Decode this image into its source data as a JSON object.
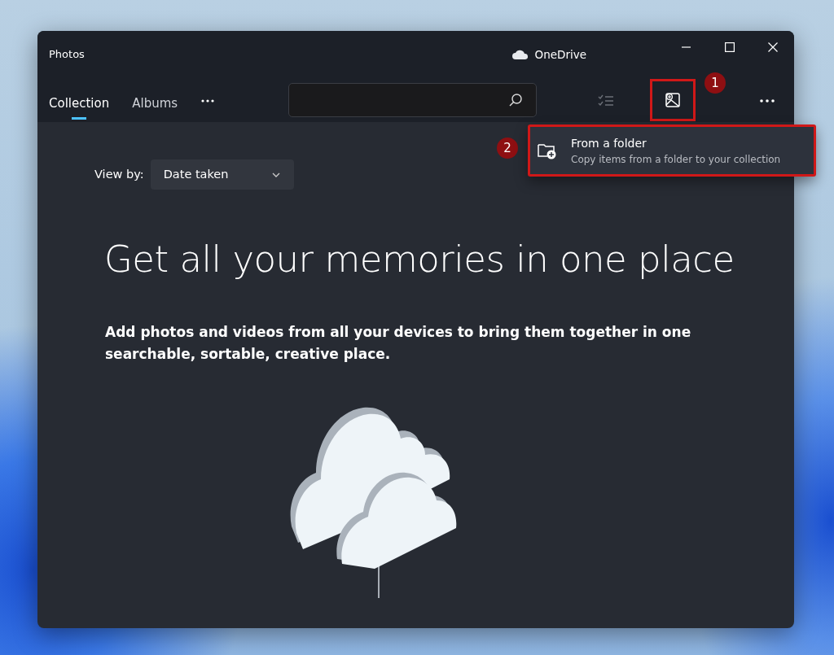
{
  "window": {
    "title": "Photos",
    "account": "OneDrive"
  },
  "tabs": [
    {
      "label": "Collection",
      "selected": true
    },
    {
      "label": "Albums",
      "selected": false
    }
  ],
  "import_button": {
    "highlighted": true,
    "step": "1"
  },
  "menu": {
    "highlighted": true,
    "step": "2",
    "items": [
      {
        "title": "From a folder",
        "description": "Copy items from a folder to your collection"
      }
    ]
  },
  "view_by": {
    "label": "View by:",
    "value": "Date taken"
  },
  "hero": {
    "heading": "Get all your memories in one place",
    "body": "Add photos and videos from all your devices to bring them together in one searchable, sortable, creative place."
  }
}
